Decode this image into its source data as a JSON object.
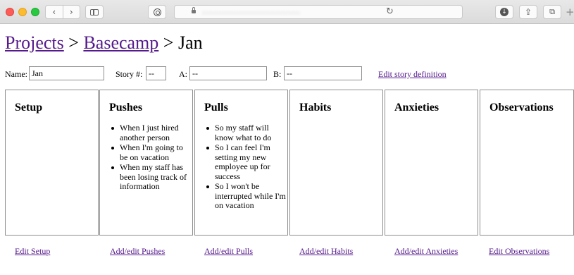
{
  "browser": {
    "nav_back": "‹",
    "nav_forward": "›",
    "share_glyph": "⇪",
    "tabs_glyph": "⧉",
    "download_glyph": "↓",
    "reload_glyph": "↻",
    "new_tab_glyph": "+",
    "url_blurred": "········································",
    "traffic_colors": {
      "close": "#fd5c56",
      "minimize": "#fdbc2e",
      "zoom": "#28c840"
    }
  },
  "breadcrumb": {
    "items": [
      {
        "label": "Projects",
        "link": true
      },
      {
        "label": "Basecamp",
        "link": true
      },
      {
        "label": "Jan",
        "link": false
      }
    ],
    "separator": ">"
  },
  "form": {
    "name_label": "Name:",
    "name_value": "Jan",
    "story_label": "Story #:",
    "story_value": "--",
    "a_label": "A:",
    "a_value": "--",
    "b_label": "B:",
    "b_value": "--",
    "edit_definition_link": "Edit story definition"
  },
  "columns": [
    {
      "title": "Setup",
      "items": [],
      "link": "Edit Setup"
    },
    {
      "title": "Pushes",
      "items": [
        "When I just hired another person",
        "When I'm going to be on vacation",
        "When my staff has been losing track of information"
      ],
      "link": "Add/edit Pushes"
    },
    {
      "title": "Pulls",
      "items": [
        "So my staff will know what to do",
        "So I can feel I'm setting my new employee up for success",
        "So I won't be interrupted while I'm on vacation"
      ],
      "link": "Add/edit Pulls"
    },
    {
      "title": "Habits",
      "items": [],
      "link": "Add/edit Habits"
    },
    {
      "title": "Anxieties",
      "items": [],
      "link": "Add/edit Anxieties"
    },
    {
      "title": "Observations",
      "items": [],
      "link": "Edit Observations"
    }
  ],
  "colors": {
    "link_visited": "#551a8b",
    "border": "#8e8e8e"
  }
}
